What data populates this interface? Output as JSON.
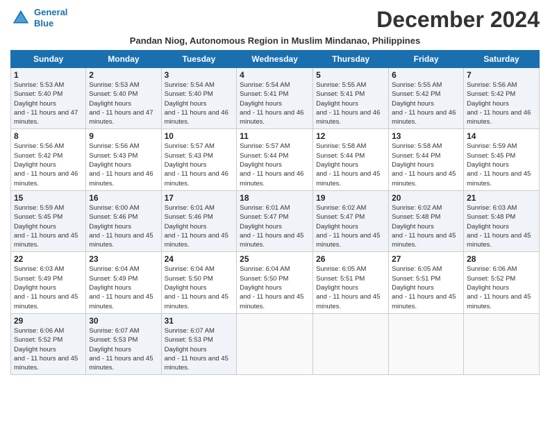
{
  "header": {
    "logo_line1": "General",
    "logo_line2": "Blue",
    "title": "December 2024",
    "subtitle": "Pandan Niog, Autonomous Region in Muslim Mindanao, Philippines"
  },
  "days_of_week": [
    "Sunday",
    "Monday",
    "Tuesday",
    "Wednesday",
    "Thursday",
    "Friday",
    "Saturday"
  ],
  "weeks": [
    [
      {
        "day": 1,
        "rise": "5:53 AM",
        "set": "5:40 PM",
        "daylight": "11 hours and 47 minutes."
      },
      {
        "day": 2,
        "rise": "5:53 AM",
        "set": "5:40 PM",
        "daylight": "11 hours and 47 minutes."
      },
      {
        "day": 3,
        "rise": "5:54 AM",
        "set": "5:40 PM",
        "daylight": "11 hours and 46 minutes."
      },
      {
        "day": 4,
        "rise": "5:54 AM",
        "set": "5:41 PM",
        "daylight": "11 hours and 46 minutes."
      },
      {
        "day": 5,
        "rise": "5:55 AM",
        "set": "5:41 PM",
        "daylight": "11 hours and 46 minutes."
      },
      {
        "day": 6,
        "rise": "5:55 AM",
        "set": "5:42 PM",
        "daylight": "11 hours and 46 minutes."
      },
      {
        "day": 7,
        "rise": "5:56 AM",
        "set": "5:42 PM",
        "daylight": "11 hours and 46 minutes."
      }
    ],
    [
      {
        "day": 8,
        "rise": "5:56 AM",
        "set": "5:42 PM",
        "daylight": "11 hours and 46 minutes."
      },
      {
        "day": 9,
        "rise": "5:56 AM",
        "set": "5:43 PM",
        "daylight": "11 hours and 46 minutes."
      },
      {
        "day": 10,
        "rise": "5:57 AM",
        "set": "5:43 PM",
        "daylight": "11 hours and 46 minutes."
      },
      {
        "day": 11,
        "rise": "5:57 AM",
        "set": "5:44 PM",
        "daylight": "11 hours and 46 minutes."
      },
      {
        "day": 12,
        "rise": "5:58 AM",
        "set": "5:44 PM",
        "daylight": "11 hours and 45 minutes."
      },
      {
        "day": 13,
        "rise": "5:58 AM",
        "set": "5:44 PM",
        "daylight": "11 hours and 45 minutes."
      },
      {
        "day": 14,
        "rise": "5:59 AM",
        "set": "5:45 PM",
        "daylight": "11 hours and 45 minutes."
      }
    ],
    [
      {
        "day": 15,
        "rise": "5:59 AM",
        "set": "5:45 PM",
        "daylight": "11 hours and 45 minutes."
      },
      {
        "day": 16,
        "rise": "6:00 AM",
        "set": "5:46 PM",
        "daylight": "11 hours and 45 minutes."
      },
      {
        "day": 17,
        "rise": "6:01 AM",
        "set": "5:46 PM",
        "daylight": "11 hours and 45 minutes."
      },
      {
        "day": 18,
        "rise": "6:01 AM",
        "set": "5:47 PM",
        "daylight": "11 hours and 45 minutes."
      },
      {
        "day": 19,
        "rise": "6:02 AM",
        "set": "5:47 PM",
        "daylight": "11 hours and 45 minutes."
      },
      {
        "day": 20,
        "rise": "6:02 AM",
        "set": "5:48 PM",
        "daylight": "11 hours and 45 minutes."
      },
      {
        "day": 21,
        "rise": "6:03 AM",
        "set": "5:48 PM",
        "daylight": "11 hours and 45 minutes."
      }
    ],
    [
      {
        "day": 22,
        "rise": "6:03 AM",
        "set": "5:49 PM",
        "daylight": "11 hours and 45 minutes."
      },
      {
        "day": 23,
        "rise": "6:04 AM",
        "set": "5:49 PM",
        "daylight": "11 hours and 45 minutes."
      },
      {
        "day": 24,
        "rise": "6:04 AM",
        "set": "5:50 PM",
        "daylight": "11 hours and 45 minutes."
      },
      {
        "day": 25,
        "rise": "6:04 AM",
        "set": "5:50 PM",
        "daylight": "11 hours and 45 minutes."
      },
      {
        "day": 26,
        "rise": "6:05 AM",
        "set": "5:51 PM",
        "daylight": "11 hours and 45 minutes."
      },
      {
        "day": 27,
        "rise": "6:05 AM",
        "set": "5:51 PM",
        "daylight": "11 hours and 45 minutes."
      },
      {
        "day": 28,
        "rise": "6:06 AM",
        "set": "5:52 PM",
        "daylight": "11 hours and 45 minutes."
      }
    ],
    [
      {
        "day": 29,
        "rise": "6:06 AM",
        "set": "5:52 PM",
        "daylight": "11 hours and 45 minutes."
      },
      {
        "day": 30,
        "rise": "6:07 AM",
        "set": "5:53 PM",
        "daylight": "11 hours and 45 minutes."
      },
      {
        "day": 31,
        "rise": "6:07 AM",
        "set": "5:53 PM",
        "daylight": "11 hours and 45 minutes."
      },
      null,
      null,
      null,
      null
    ]
  ]
}
